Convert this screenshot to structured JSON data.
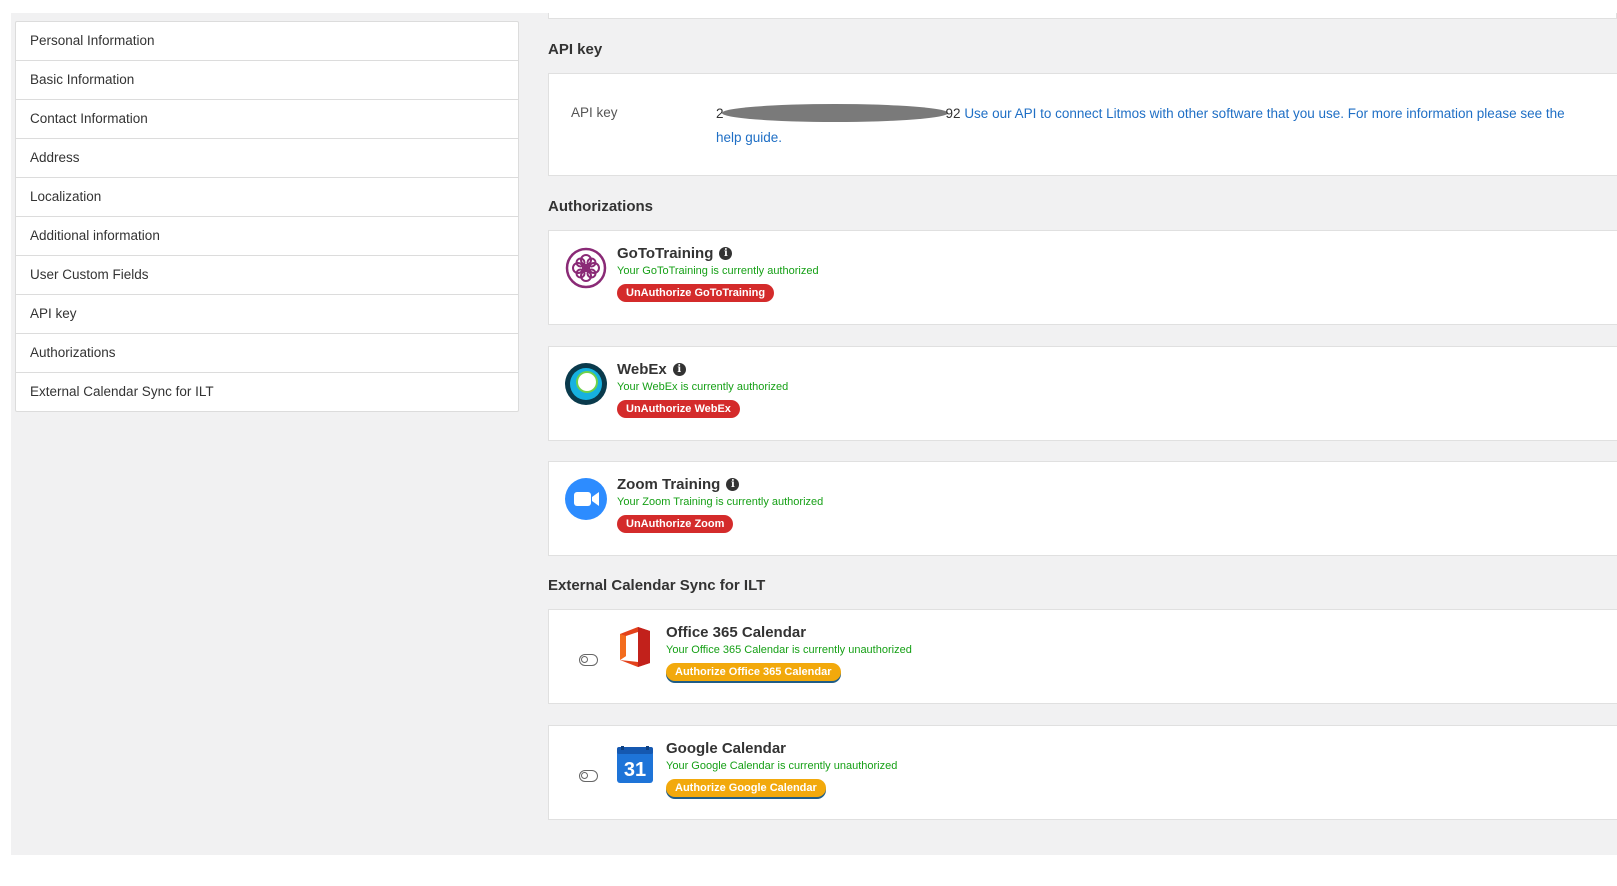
{
  "sidebar": {
    "items": [
      {
        "label": "Personal Information"
      },
      {
        "label": "Basic Information"
      },
      {
        "label": "Contact Information"
      },
      {
        "label": "Address"
      },
      {
        "label": "Localization"
      },
      {
        "label": "Additional information"
      },
      {
        "label": "User Custom Fields"
      },
      {
        "label": "API key"
      },
      {
        "label": "Authorizations"
      },
      {
        "label": "External Calendar Sync for ILT"
      }
    ]
  },
  "api_key": {
    "section_title": "API key",
    "label": "API key",
    "value_prefix": "2",
    "value_suffix": "92",
    "link_text": "Use our API to connect Litmos with other software that you use. For more information please see the help guide."
  },
  "authorizations": {
    "section_title": "Authorizations",
    "services": [
      {
        "name": "GoToTraining",
        "status": "Your GoToTraining is currently authorized",
        "button": "UnAuthorize GoToTraining",
        "icon": "gototraining-logo-icon"
      },
      {
        "name": "WebEx",
        "status": "Your WebEx is currently authorized",
        "button": "UnAuthorize WebEx",
        "icon": "webex-logo-icon"
      },
      {
        "name": "Zoom Training",
        "status": "Your Zoom Training is currently authorized",
        "button": "UnAuthorize Zoom",
        "icon": "zoom-logo-icon"
      }
    ]
  },
  "calendar_sync": {
    "section_title": "External Calendar Sync for ILT",
    "calendars": [
      {
        "name": "Office 365 Calendar",
        "status": "Your Office 365 Calendar is currently unauthorized",
        "button": "Authorize Office 365 Calendar",
        "icon": "office365-logo-icon",
        "enabled": false
      },
      {
        "name": "Google Calendar",
        "status": "Your Google Calendar is currently unauthorized",
        "button": "Authorize Google Calendar",
        "icon": "google-calendar-logo-icon",
        "calendar_day": "31",
        "enabled": false
      }
    ]
  },
  "colors": {
    "link": "#1f6fc5",
    "status_green": "#16a016",
    "danger": "#d42b2b",
    "warning": "#f2a90c"
  }
}
